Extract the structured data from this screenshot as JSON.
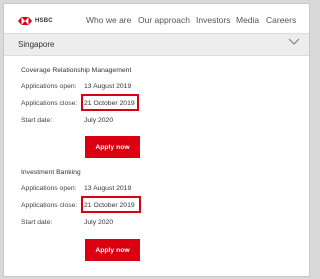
{
  "header": {
    "logo_text": "HSBC",
    "nav": [
      "Who we are",
      "Our approach",
      "Investors",
      "Media",
      "Careers"
    ]
  },
  "region": {
    "selected": "Singapore",
    "icon": "chevron-down-icon"
  },
  "programmes": [
    {
      "title": "Coverage Relationship Management",
      "open_label": "Applications open:",
      "open_value": "13 August 2019",
      "close_label": "Applications close:",
      "close_value": "21 October 2019",
      "start_label": "Start date:",
      "start_value": "July 2020",
      "button": "Apply now"
    },
    {
      "title": "Investment Banking",
      "open_label": "Applications open:",
      "open_value": "13 August 2019",
      "close_label": "Applications close:",
      "close_value": "21 October 2019",
      "start_label": "Start date:",
      "start_value": "July 2020",
      "button": "Apply now"
    }
  ],
  "colors": {
    "brand_red": "#db0011",
    "region_bar": "#ededed"
  }
}
